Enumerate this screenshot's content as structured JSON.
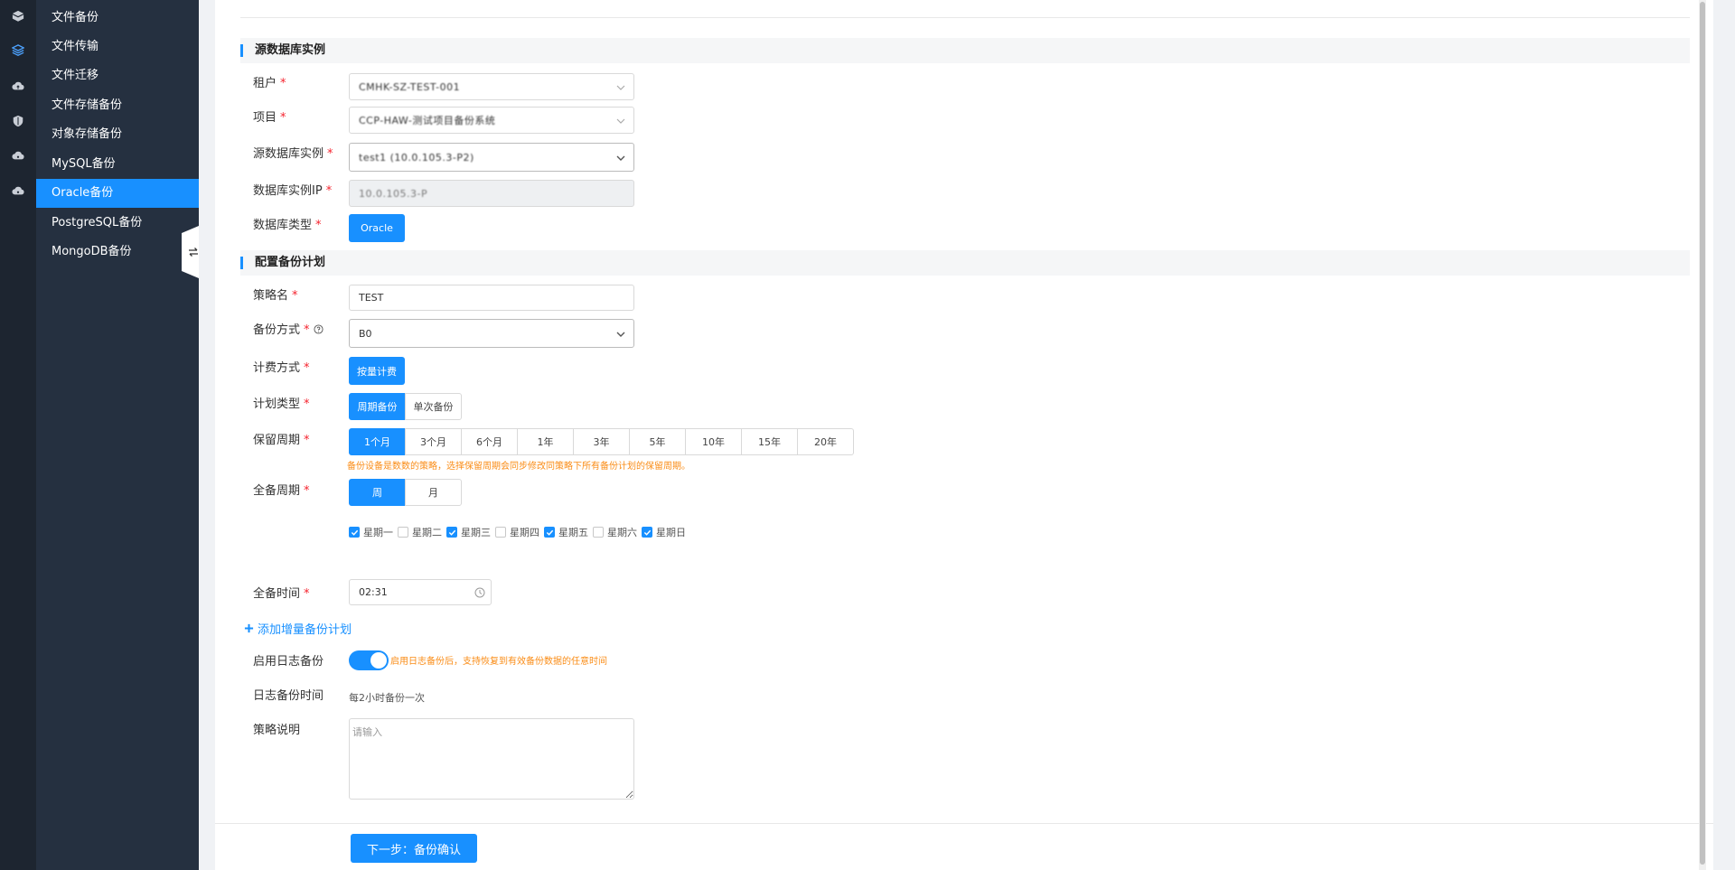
{
  "colors": {
    "accent": "#1890ff",
    "rail_bg": "#1d2530",
    "subnav_bg": "#253040",
    "required": "#f5222d",
    "hint": "#fa8c16"
  },
  "rail": {
    "icons": [
      "box-icon",
      "database-icon",
      "cloud-upload-icon",
      "shield-icon",
      "cloud-icon",
      "cloud-icon"
    ]
  },
  "subnav": {
    "items": [
      {
        "label": "文件备份",
        "active": false
      },
      {
        "label": "文件传输",
        "active": false
      },
      {
        "label": "文件迁移",
        "active": false
      },
      {
        "label": "文件存储备份",
        "active": false
      },
      {
        "label": "对象存储备份",
        "active": false
      },
      {
        "label": "MySQL备份",
        "active": false
      },
      {
        "label": "Oracle备份",
        "active": true
      },
      {
        "label": "PostgreSQL备份",
        "active": false
      },
      {
        "label": "MongoDB备份",
        "active": false
      }
    ]
  },
  "source_section": {
    "title": "源数据库实例",
    "tenant": {
      "label": "租户",
      "value": "CMHK-SZ-TEST-001"
    },
    "project": {
      "label": "项目",
      "value": "CCP-HAW-测试项目备份系统"
    },
    "instance": {
      "label": "源数据库实例",
      "value": "test1 (10.0.105.3-P2)"
    },
    "ip": {
      "label": "数据库实例IP",
      "value": "10.0.105.3-P"
    },
    "db_type": {
      "label": "数据库类型",
      "value": "Oracle"
    }
  },
  "plan_section": {
    "title": "配置备份计划",
    "policy_name": {
      "label": "策略名",
      "value": "TEST"
    },
    "backup_method": {
      "label": "备份方式",
      "value": "B0"
    },
    "billing": {
      "label": "计费方式",
      "value": "按量计费"
    },
    "plan_type": {
      "label": "计划类型",
      "options": [
        "周期备份",
        "单次备份"
      ],
      "selected": 0
    },
    "retention": {
      "label": "保留周期",
      "options": [
        "1个月",
        "3个月",
        "6个月",
        "1年",
        "3年",
        "5年",
        "10年",
        "15年",
        "20年"
      ],
      "selected": 0,
      "hint": "备份设备是数数的策略，选择保留周期会同步修改同策略下所有备份计划的保留周期。"
    },
    "full_cycle": {
      "label": "全备周期",
      "options": [
        "周",
        "月"
      ],
      "selected": 0
    },
    "weekdays": [
      {
        "label": "星期一",
        "checked": true
      },
      {
        "label": "星期二",
        "checked": false
      },
      {
        "label": "星期三",
        "checked": true
      },
      {
        "label": "星期四",
        "checked": false
      },
      {
        "label": "星期五",
        "checked": true
      },
      {
        "label": "星期六",
        "checked": false
      },
      {
        "label": "星期日",
        "checked": true
      }
    ],
    "full_time": {
      "label": "全备时间",
      "value": "02:31"
    },
    "add_incremental": "添加增量备份计划",
    "log_backup": {
      "label": "启用日志备份",
      "enabled": true,
      "hint": "启用日志备份后，支持恢复到有效备份数据的任意时间"
    },
    "log_time": {
      "label": "日志备份时间",
      "value": "每2小时备份一次"
    },
    "description": {
      "label": "策略说明",
      "placeholder": "请输入"
    }
  },
  "footer": {
    "next_label": "下一步：备份确认"
  }
}
